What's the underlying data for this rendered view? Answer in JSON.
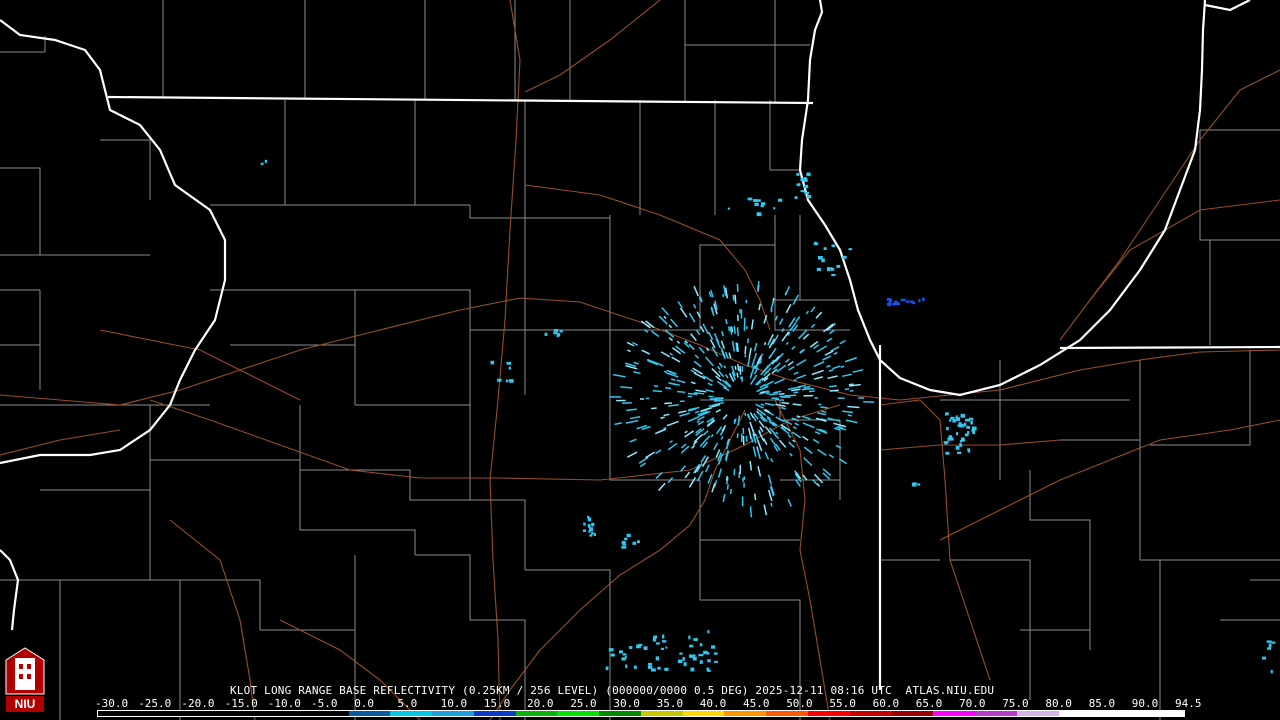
{
  "caption": {
    "radar": "KLOT",
    "product": "LONG RANGE BASE REFLECTIVITY",
    "resolution": "(0.25KM / 256 LEVEL)",
    "volume": "(000000/0000",
    "elevation": "0.5 DEG)",
    "date": "2025-12-11",
    "time": "08:16 UTC",
    "source": "ATLAS.NIU.EDU"
  },
  "logo": {
    "text": "NIU",
    "icon": "niu-tower-logo-icon"
  },
  "scale": {
    "ticks": [
      "-30.0",
      "-25.0",
      "-20.0",
      "-15.0",
      "-10.0",
      "-5.0",
      "0.0",
      "5.0",
      "10.0",
      "15.0",
      "20.0",
      "25.0",
      "30.0",
      "35.0",
      "40.0",
      "45.0",
      "50.0",
      "55.0",
      "60.0",
      "65.0",
      "70.0",
      "75.0",
      "80.0",
      "85.0",
      "90.0",
      "94.5"
    ],
    "colors": [
      "#000000",
      "#000000",
      "#000000",
      "#000000",
      "#000000",
      "#000000",
      "#0a5aa0",
      "#00c8e6",
      "#1ea0dc",
      "#0a3cc8",
      "#08b408",
      "#04e404",
      "#028c02",
      "#c8c800",
      "#ffd800",
      "#ff9600",
      "#ff5a00",
      "#ff0000",
      "#c80000",
      "#a00000",
      "#ff00ff",
      "#b43cc8",
      "#d2b4e6",
      "#ffffff",
      "#ffffff",
      "#ffffff"
    ]
  },
  "map_colors": {
    "state_border": "#ffffff",
    "county_border": "#8c8c8c",
    "highway": "#a0522d",
    "echo": "#2ec8f0",
    "echo_strong": "#1e50e6"
  }
}
